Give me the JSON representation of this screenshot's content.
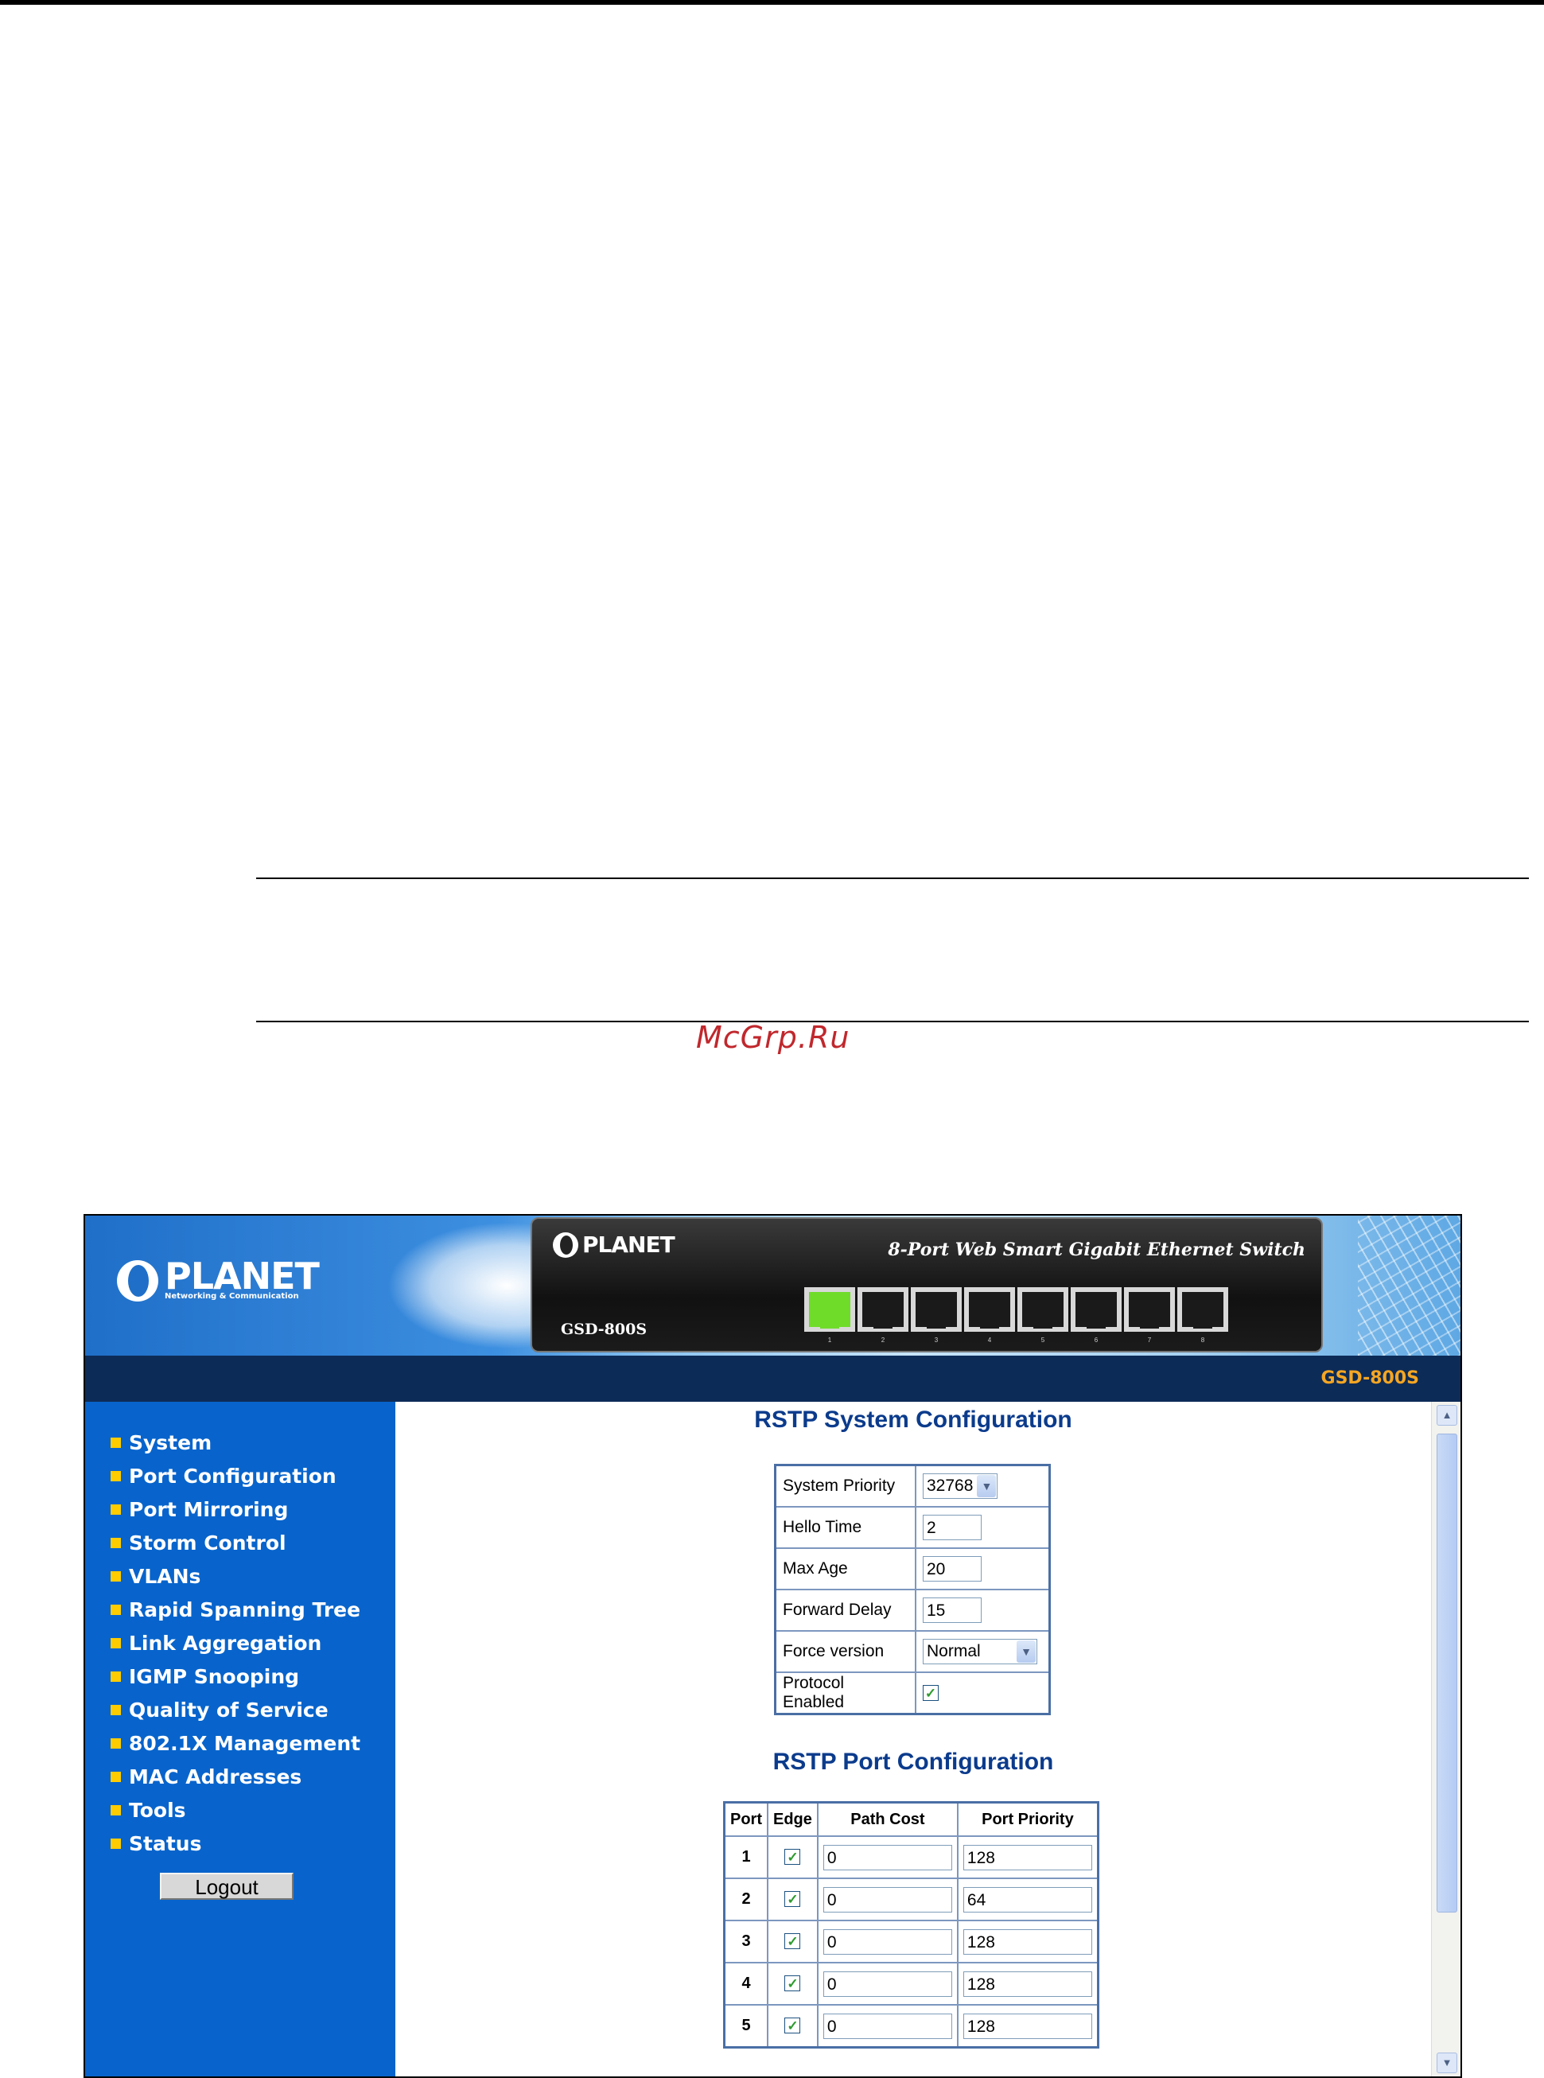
{
  "watermark": "McGrp.Ru",
  "header": {
    "logo_text": "PLANET",
    "logo_subtitle": "Networking & Communication",
    "device_logo_text": "PLANET",
    "device_title": "8-Port Web Smart Gigabit Ethernet Switch",
    "device_model": "GSD-800S",
    "ports": [
      {
        "label": "1",
        "active": true
      },
      {
        "label": "2",
        "active": false
      },
      {
        "label": "3",
        "active": false
      },
      {
        "label": "4",
        "active": false
      },
      {
        "label": "5",
        "active": false
      },
      {
        "label": "6",
        "active": false
      },
      {
        "label": "7",
        "active": false
      },
      {
        "label": "8",
        "active": false
      }
    ]
  },
  "navbar": {
    "model": "GSD-800S"
  },
  "sidebar": {
    "items": [
      {
        "label": "System"
      },
      {
        "label": "Port Configuration"
      },
      {
        "label": "Port Mirroring"
      },
      {
        "label": "Storm Control"
      },
      {
        "label": "VLANs"
      },
      {
        "label": "Rapid Spanning Tree"
      },
      {
        "label": "Link Aggregation"
      },
      {
        "label": "IGMP Snooping"
      },
      {
        "label": "Quality of Service"
      },
      {
        "label": "802.1X Management"
      },
      {
        "label": "MAC Addresses"
      },
      {
        "label": "Tools"
      },
      {
        "label": "Status"
      }
    ],
    "logout_label": "Logout"
  },
  "rstp_system": {
    "title": "RSTP System Configuration",
    "system_priority": {
      "label": "System Priority",
      "value": "32768"
    },
    "hello_time": {
      "label": "Hello Time",
      "value": "2"
    },
    "max_age": {
      "label": "Max Age",
      "value": "20"
    },
    "forward_delay": {
      "label": "Forward Delay",
      "value": "15"
    },
    "force_version": {
      "label": "Force version",
      "value": "Normal"
    },
    "protocol_enabled": {
      "label": "Protocol Enabled",
      "checked": true
    }
  },
  "rstp_port": {
    "title": "RSTP Port Configuration",
    "columns": [
      "Port",
      "Edge",
      "Path Cost",
      "Port Priority"
    ],
    "rows": [
      {
        "port": "1",
        "edge": true,
        "path_cost": "0",
        "priority": "128"
      },
      {
        "port": "2",
        "edge": true,
        "path_cost": "0",
        "priority": "64"
      },
      {
        "port": "3",
        "edge": true,
        "path_cost": "0",
        "priority": "128"
      },
      {
        "port": "4",
        "edge": true,
        "path_cost": "0",
        "priority": "128"
      },
      {
        "port": "5",
        "edge": true,
        "path_cost": "0",
        "priority": "128"
      }
    ]
  },
  "colors": {
    "sidebar_bg": "#0864cc",
    "navbar_bg": "#0d2b57",
    "heading": "#0b3b8c",
    "bullet": "#ffcc00",
    "model_accent": "#f5a623"
  }
}
